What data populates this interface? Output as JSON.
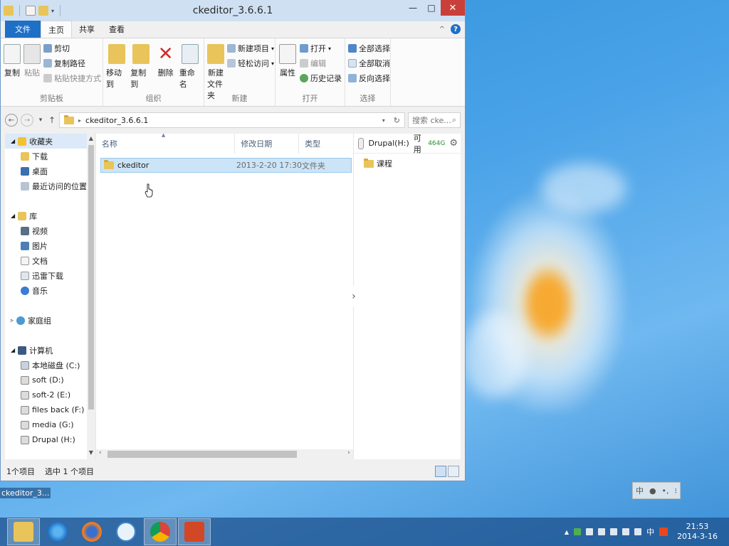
{
  "window": {
    "title": "ckeditor_3.6.6.1",
    "controls": {
      "minimize": "—",
      "maximize": "□",
      "close": "✕"
    }
  },
  "ribbon_tabs": [
    "文件",
    "主页",
    "共享",
    "查看"
  ],
  "ribbon": {
    "clipboard": {
      "copy": "复制",
      "paste": "粘贴",
      "cut": "剪切",
      "copy_path": "复制路径",
      "paste_shortcut": "粘贴快捷方式",
      "label": "剪贴板"
    },
    "organize": {
      "move_to": "移动到",
      "copy_to": "复制到",
      "delete": "删除",
      "rename": "重命名",
      "label": "组织"
    },
    "new": {
      "new_folder_line1": "新建",
      "new_folder_line2": "文件夹",
      "new_item": "新建项目",
      "easy_access": "轻松访问",
      "label": "新建"
    },
    "open": {
      "properties": "属性",
      "open": "打开",
      "edit": "编辑",
      "history": "历史记录",
      "label": "打开"
    },
    "select": {
      "select_all": "全部选择",
      "select_none": "全部取消",
      "invert": "反向选择",
      "label": "选择"
    }
  },
  "address": {
    "path": "ckeditor_3.6.6.1",
    "search_placeholder": "搜索 cke..."
  },
  "nav_pane": {
    "favorites": "收藏夹",
    "fav_items": [
      "下载",
      "桌面",
      "最近访问的位置"
    ],
    "libraries": "库",
    "lib_items": [
      "视频",
      "图片",
      "文档",
      "迅雷下载",
      "音乐"
    ],
    "homegroup": "家庭组",
    "computer": "计算机",
    "drives": [
      "本地磁盘 (C:)",
      "soft (D:)",
      "soft-2 (E:)",
      "files back (F:)",
      "media (G:)",
      "Drupal (H:)"
    ]
  },
  "file_list": {
    "columns": [
      "名称",
      "修改日期",
      "类型"
    ],
    "rows": [
      {
        "name": "ckeditor",
        "date": "2013-2-20 17:30",
        "type": "文件夹"
      }
    ]
  },
  "preview": {
    "drive": "Drupal(H:)",
    "avail_label": "可用",
    "avail_value": "464G",
    "items": [
      "课程"
    ]
  },
  "status": {
    "count": "1个项目",
    "selected": "选中 1 个项目"
  },
  "desktop": {
    "icon_label": "ckeditor_3..."
  },
  "ime": {
    "lang": "中"
  },
  "taskbar": {
    "apps": [
      "file-explorer",
      "internet-explorer",
      "firefox",
      "sogou",
      "chrome",
      "powerpoint"
    ],
    "tray_lang": "中",
    "time": "21:53",
    "date": "2014-3-16"
  },
  "colors": {
    "accent": "#1e6fc6",
    "selection": "#cce4f7",
    "close": "#c9403a"
  }
}
